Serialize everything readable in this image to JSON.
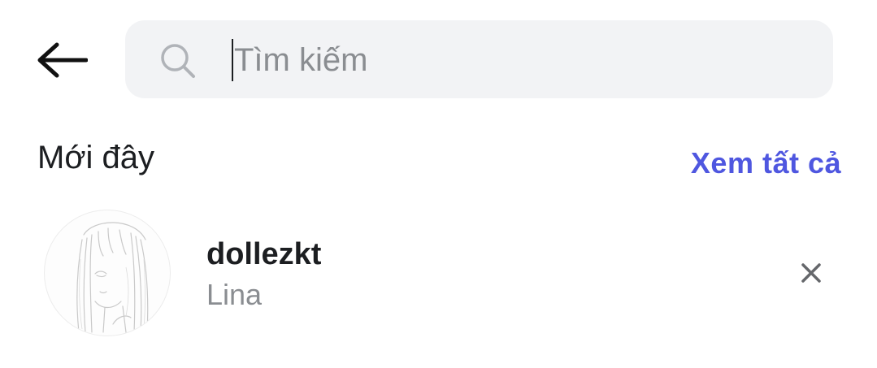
{
  "header": {
    "back_icon": "arrow-left-icon"
  },
  "search": {
    "icon": "search-icon",
    "placeholder": "Tìm kiếm",
    "value": ""
  },
  "recent": {
    "title": "Mới đây",
    "see_all_label": "Xem tất cả",
    "items": [
      {
        "username": "dollezkt",
        "full_name": "Lina",
        "avatar": "sketch-portrait-avatar",
        "remove_icon": "close-icon"
      }
    ]
  },
  "colors": {
    "accent": "#4f57e0",
    "search_bg": "#f2f3f5",
    "secondary_text": "#8a8d91",
    "primary_text": "#1c1e21"
  }
}
